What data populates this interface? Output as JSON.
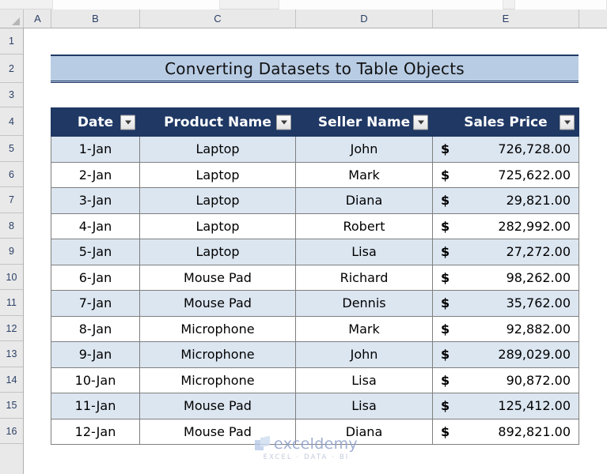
{
  "app": {
    "type": "spreadsheet",
    "colors": {
      "header_navy": "#1F3864",
      "banner_blue": "#B8CCE4",
      "band_blue": "#DCE6F1",
      "grid_gray": "#7f7f7f",
      "gutter_gray": "#e9e9e9"
    }
  },
  "grid": {
    "column_headers": [
      "A",
      "B",
      "C",
      "D",
      "E"
    ],
    "row_headers": [
      "1",
      "2",
      "3",
      "4",
      "5",
      "6",
      "7",
      "8",
      "9",
      "10",
      "11",
      "12",
      "13",
      "14",
      "15",
      "16"
    ],
    "select_all_label": ""
  },
  "banner": {
    "title": "Converting Datasets to Table Objects"
  },
  "table": {
    "columns": [
      {
        "label": "Date",
        "filter_icon": "filter-dropdown-icon"
      },
      {
        "label": "Product Name",
        "filter_icon": "filter-dropdown-icon"
      },
      {
        "label": "Seller Name",
        "filter_icon": "filter-dropdown-icon"
      },
      {
        "label": "Sales Price",
        "filter_icon": "filter-dropdown-icon"
      }
    ],
    "currency_symbol": "$",
    "rows": [
      {
        "date": "1-Jan",
        "product": "Laptop",
        "seller": "John",
        "price": "726,728.00"
      },
      {
        "date": "2-Jan",
        "product": "Laptop",
        "seller": "Mark",
        "price": "725,622.00"
      },
      {
        "date": "3-Jan",
        "product": "Laptop",
        "seller": "Diana",
        "price": "29,821.00"
      },
      {
        "date": "4-Jan",
        "product": "Laptop",
        "seller": "Robert",
        "price": "282,992.00"
      },
      {
        "date": "5-Jan",
        "product": "Laptop",
        "seller": "Lisa",
        "price": "27,272.00"
      },
      {
        "date": "6-Jan",
        "product": "Mouse Pad",
        "seller": "Richard",
        "price": "98,262.00"
      },
      {
        "date": "7-Jan",
        "product": "Mouse Pad",
        "seller": "Dennis",
        "price": "35,762.00"
      },
      {
        "date": "8-Jan",
        "product": "Microphone",
        "seller": "Mark",
        "price": "92,882.00"
      },
      {
        "date": "9-Jan",
        "product": "Microphone",
        "seller": "John",
        "price": "289,029.00"
      },
      {
        "date": "10-Jan",
        "product": "Microphone",
        "seller": "Lisa",
        "price": "90,872.00"
      },
      {
        "date": "11-Jan",
        "product": "Mouse Pad",
        "seller": "Lisa",
        "price": "125,412.00"
      },
      {
        "date": "12-Jan",
        "product": "Mouse Pad",
        "seller": "Diana",
        "price": "892,821.00"
      }
    ]
  },
  "watermark": {
    "name": "exceldemy",
    "tagline": "EXCEL · DATA · BI",
    "logo_icon": "cube-logo-icon"
  }
}
